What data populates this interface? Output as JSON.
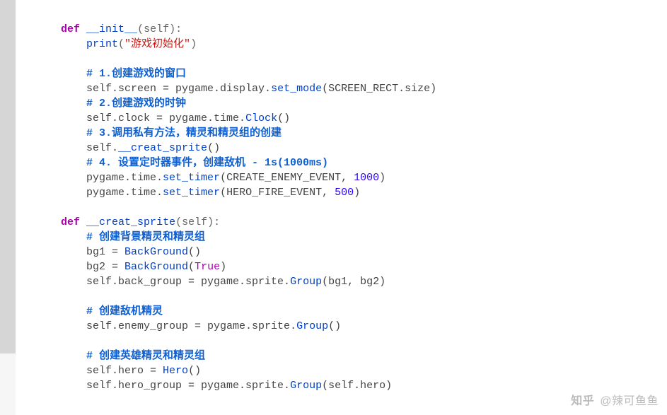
{
  "code": {
    "line01": {
      "indent": "    ",
      "kw": "def",
      "sp": " ",
      "fn": "__init__",
      "par": "(self):"
    },
    "line02": {
      "indent": "        ",
      "fn": "print",
      "par_open": "(",
      "str": "\"游戏初始化\"",
      "par_close": ")"
    },
    "blank03": "",
    "line04": {
      "indent": "        ",
      "cmt": "# 1.创建游戏的窗口"
    },
    "line05": {
      "indent": "        ",
      "text_a": "self.screen = pygame.display.",
      "fn": "set_mode",
      "text_b": "(SCREEN_RECT.size)"
    },
    "line06": {
      "indent": "        ",
      "cmt": "# 2.创建游戏的时钟"
    },
    "line07": {
      "indent": "        ",
      "text_a": "self.clock = pygame.time.",
      "fn": "Clock",
      "text_b": "()"
    },
    "line08": {
      "indent": "        ",
      "cmt": "# 3.调用私有方法，精灵和精灵组的创建"
    },
    "line09": {
      "indent": "        ",
      "text_a": "self.",
      "fn": "__creat_sprite",
      "text_b": "()"
    },
    "line10": {
      "indent": "        ",
      "cmt": "# 4. 设置定时器事件，创建敌机 - 1s(1000ms)"
    },
    "line11": {
      "indent": "        ",
      "text_a": "pygame.time.",
      "fn": "set_timer",
      "text_b": "(CREATE_ENEMY_EVENT, ",
      "num": "1000",
      "text_c": ")"
    },
    "line12": {
      "indent": "        ",
      "text_a": "pygame.time.",
      "fn": "set_timer",
      "text_b": "(HERO_FIRE_EVENT, ",
      "num": "500",
      "text_c": ")"
    },
    "blank13": "",
    "line14": {
      "indent": "    ",
      "kw": "def",
      "sp": " ",
      "fn": "__creat_sprite",
      "par": "(self):"
    },
    "line15": {
      "indent": "        ",
      "cmt": "# 创建背景精灵和精灵组"
    },
    "line16": {
      "indent": "        ",
      "text_a": "bg1 = ",
      "fn": "BackGround",
      "text_b": "()"
    },
    "line17": {
      "indent": "        ",
      "text_a": "bg2 = ",
      "fn": "BackGround",
      "text_b": "(",
      "bool": "True",
      "text_c": ")"
    },
    "line18": {
      "indent": "        ",
      "text_a": "self.back_group = pygame.sprite.",
      "fn": "Group",
      "text_b": "(bg1, bg2)"
    },
    "blank19": "",
    "line20": {
      "indent": "        ",
      "cmt": "# 创建敌机精灵"
    },
    "line21": {
      "indent": "        ",
      "text_a": "self.enemy_group = pygame.sprite.",
      "fn": "Group",
      "text_b": "()"
    },
    "blank22": "",
    "line23": {
      "indent": "        ",
      "cmt": "# 创建英雄精灵和精灵组"
    },
    "line24": {
      "indent": "        ",
      "text_a": "self.hero = ",
      "fn": "Hero",
      "text_b": "()"
    },
    "line25": {
      "indent": "        ",
      "text_a": "self.hero_group = pygame.sprite.",
      "fn": "Group",
      "text_b": "(self.hero)"
    }
  },
  "watermark": {
    "logo": "知乎",
    "author": "@辣可鱼鱼"
  }
}
